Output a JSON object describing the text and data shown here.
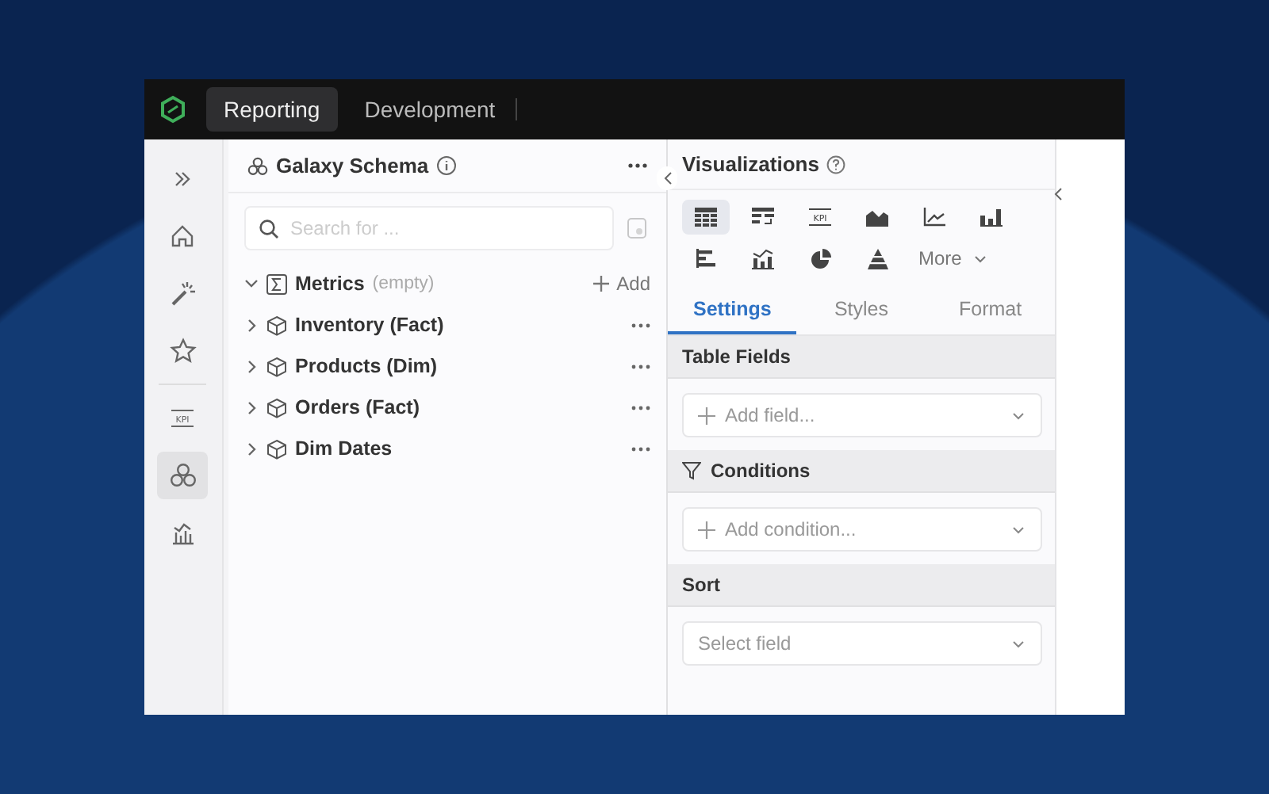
{
  "top_tabs": [
    {
      "label": "Reporting",
      "selected": true
    },
    {
      "label": "Development",
      "selected": false
    }
  ],
  "rail": [
    {
      "kind": "expand",
      "selected": false
    },
    {
      "kind": "home",
      "selected": false
    },
    {
      "kind": "wand",
      "selected": false
    },
    {
      "kind": "star",
      "selected": false
    },
    {
      "kind": "kpi",
      "label": "KPI",
      "selected": false
    },
    {
      "kind": "schema",
      "selected": true
    },
    {
      "kind": "chart",
      "selected": false
    }
  ],
  "schema_panel": {
    "title": "Galaxy Schema",
    "search": {
      "placeholder": "Search for ..."
    },
    "items": [
      {
        "kind": "metrics",
        "label": "Metrics",
        "note": "(empty)",
        "action": "Add",
        "expanded": true
      },
      {
        "kind": "table",
        "label": "Inventory (Fact)",
        "expanded": false
      },
      {
        "kind": "table",
        "label": "Products (Dim)",
        "expanded": false
      },
      {
        "kind": "table",
        "label": "Orders (Fact)",
        "expanded": false
      },
      {
        "kind": "table",
        "label": "Dim Dates",
        "expanded": false
      }
    ]
  },
  "visualizations": {
    "title": "Visualizations",
    "types": [
      {
        "kind": "table",
        "selected": true
      },
      {
        "kind": "pivot",
        "selected": false
      },
      {
        "kind": "kpi",
        "label": "KPI",
        "selected": false
      },
      {
        "kind": "area",
        "selected": false
      },
      {
        "kind": "line",
        "selected": false
      },
      {
        "kind": "column",
        "selected": false
      },
      {
        "kind": "bar",
        "selected": false
      },
      {
        "kind": "combo",
        "selected": false
      },
      {
        "kind": "pie",
        "selected": false
      },
      {
        "kind": "funnel",
        "selected": false
      }
    ],
    "more": "More",
    "tabs": [
      {
        "label": "Settings",
        "selected": true
      },
      {
        "label": "Styles",
        "selected": false
      },
      {
        "label": "Format",
        "selected": false
      }
    ],
    "sections": [
      {
        "title": "Table Fields",
        "kind": "plain",
        "field": {
          "placeholder": "Add field...",
          "add": true
        }
      },
      {
        "title": "Conditions",
        "kind": "filter",
        "field": {
          "placeholder": "Add condition...",
          "add": true
        }
      },
      {
        "title": "Sort",
        "kind": "plain",
        "field": {
          "placeholder": "Select field",
          "add": false
        }
      }
    ]
  }
}
